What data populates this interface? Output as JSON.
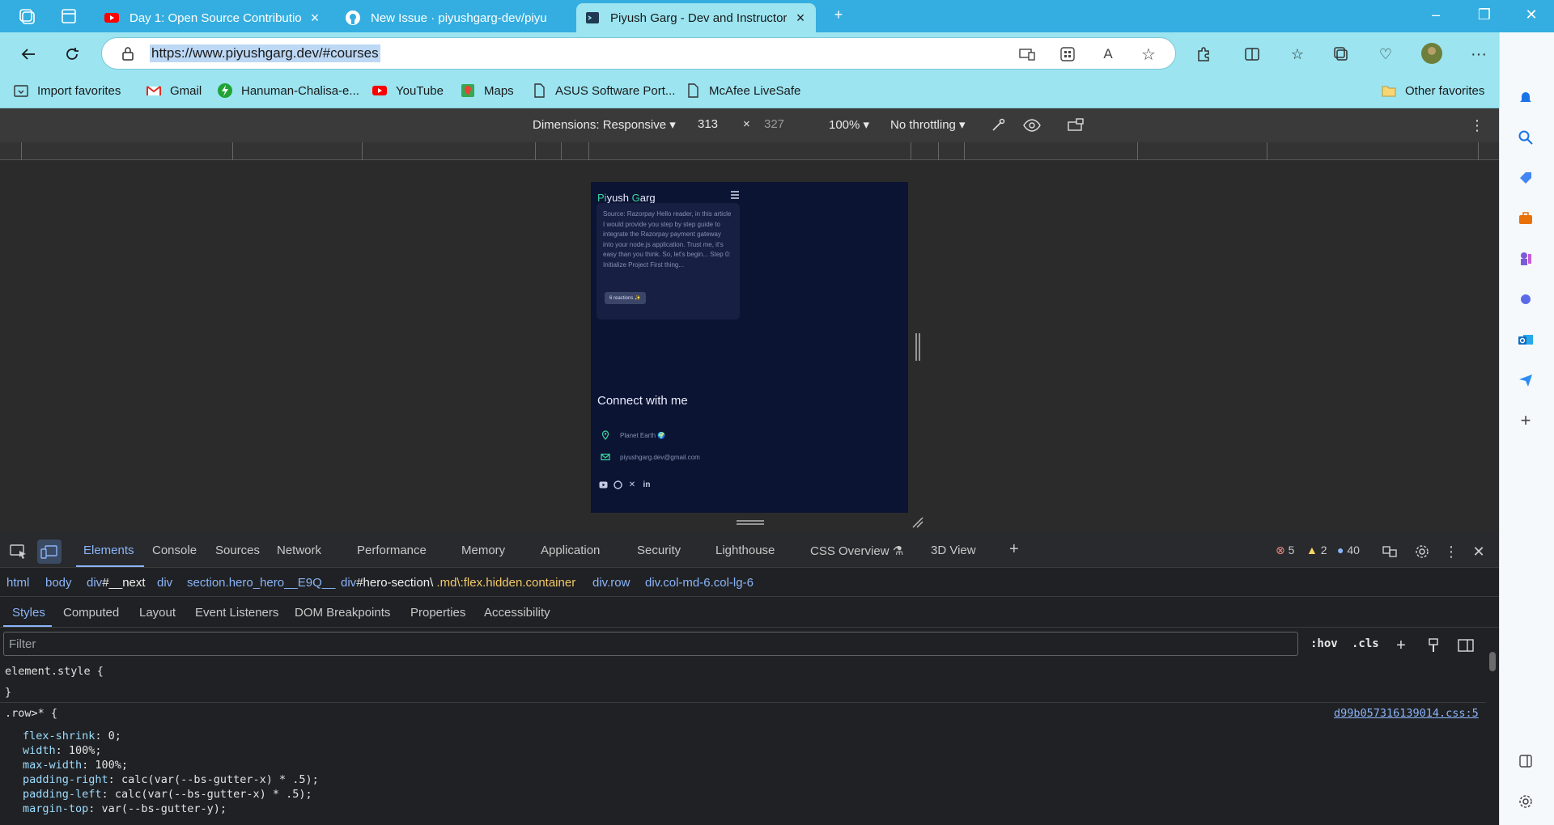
{
  "browser": {
    "tabs": [
      {
        "title": "Day 1: Open Source Contribution",
        "icon": "youtube-icon",
        "active": false
      },
      {
        "title": "New Issue · piyushgarg-dev/piyu",
        "icon": "github-icon",
        "active": false
      },
      {
        "title": "Piyush Garg - Dev and Instructor",
        "icon": "site-icon",
        "active": true
      }
    ],
    "url": "https://www.piyushgarg.dev/#courses",
    "favorites": [
      {
        "label": "Import favorites",
        "icon": "import-icon"
      },
      {
        "label": "Gmail",
        "icon": "gmail-icon"
      },
      {
        "label": "Hanuman-Chalisa-e...",
        "icon": "bolt-icon"
      },
      {
        "label": "YouTube",
        "icon": "youtube-icon"
      },
      {
        "label": "Maps",
        "icon": "maps-icon"
      },
      {
        "label": "ASUS Software Port...",
        "icon": "page-icon"
      },
      {
        "label": "McAfee LiveSafe",
        "icon": "page-icon"
      }
    ],
    "other_favorites": "Other favorites",
    "colors": {
      "tabstrip": "#34aee0",
      "toolbar": "#9be4f0"
    }
  },
  "device_toolbar": {
    "dimensions_label": "Dimensions: Responsive",
    "width": "313",
    "times": "×",
    "height": "327",
    "zoom": "100%",
    "throttling": "No throttling"
  },
  "site": {
    "logo_first": "Pi",
    "logo_rest": "yush ",
    "logo_g": "G",
    "logo_end": "arg",
    "post_excerpt": "Source: Razorpay Hello reader, in this article I would provide you step by step guide to integrate the Razorpay payment gateway into your node.js application. Trust me, it's easy than you think. So, let's begin... Step 0: Initialize Project First thing...",
    "reactions": "6 reactions ✨",
    "connect_heading": "Connect with me",
    "location": "Planet Earth 🌍",
    "email": "piyushgarg.dev@gmail.com"
  },
  "devtools": {
    "tabs": [
      "Elements",
      "Console",
      "Sources",
      "Network",
      "Performance",
      "Memory",
      "Application",
      "Security",
      "Lighthouse",
      "CSS Overview",
      "3D View"
    ],
    "counts": {
      "errors": "5",
      "warnings": "2",
      "info": "40"
    },
    "breadcrumbs": [
      {
        "tag": "html",
        "rest": ""
      },
      {
        "tag": "body",
        "rest": ""
      },
      {
        "tag": "div",
        "id": "#__next",
        "cls": ""
      },
      {
        "tag": "div",
        "rest": ""
      },
      {
        "tag": "section",
        "cls": ".hero_hero__E9Q__"
      },
      {
        "tag": "div",
        "id": "#hero-section\\",
        "cls": ".md\\:flex.hidden.container"
      },
      {
        "tag": "div",
        "cls": ".row"
      },
      {
        "tag": "div",
        "cls": ".col-md-6.col-lg-6"
      }
    ],
    "subtabs": [
      "Styles",
      "Computed",
      "Layout",
      "Event Listeners",
      "DOM Breakpoints",
      "Properties",
      "Accessibility"
    ],
    "filter_placeholder": "Filter",
    "hov": ":hov",
    "cls": ".cls",
    "element_style_open": "element.style {",
    "element_style_close": "}",
    "rule_selector": ".row>* {",
    "rule_source": "d99b057316139014.css:5",
    "declarations": [
      {
        "prop": "flex-shrink",
        "value": "0;"
      },
      {
        "prop": "width",
        "value": "100%;"
      },
      {
        "prop": "max-width",
        "value": "100%;"
      },
      {
        "prop": "padding-right",
        "value": "calc(var(--bs-gutter-x) * .5);"
      },
      {
        "prop": "padding-left",
        "value": "calc(var(--bs-gutter-x) * .5);"
      },
      {
        "prop": "margin-top",
        "value": "var(--bs-gutter-y);"
      }
    ]
  }
}
